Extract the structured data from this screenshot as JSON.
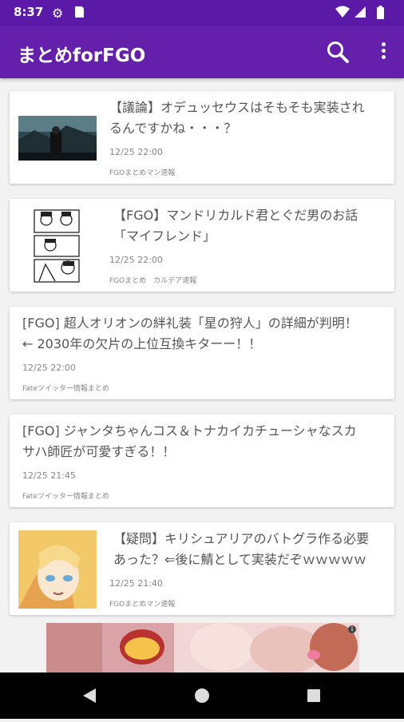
{
  "status_bar": {
    "time": "8:37",
    "icons": [
      "gear-icon",
      "sd-card-icon",
      "wifi-icon",
      "signal-icon",
      "battery-icon"
    ]
  },
  "app_bar": {
    "title": "まとめforFGO",
    "actions": [
      "search-icon",
      "more-vert-icon"
    ],
    "color": "#6420aa"
  },
  "articles": [
    {
      "title_line1": "【議論】オデュッセウスはそもそも実装され",
      "title_line2": "るんですかね・・・？",
      "time": "12/25 22:00",
      "source": "FGOまとめマン速報",
      "has_thumbnail": true
    },
    {
      "title_line1": "【FGO】マンドリカルド君とぐだ男のお話",
      "title_line2": "「マイフレンド」",
      "time": "12/25 22:00",
      "source": "FGOまとめ　カルデア速報",
      "has_thumbnail": true
    },
    {
      "title_line1": "[FGO] 超人オリオンの絆礼装「星の狩人」の詳細が判明！",
      "title_line2": "← 2030年の欠片の上位互換キターー！！",
      "time": "12/25 22:00",
      "source": "Fateツイッター情報まとめ",
      "has_thumbnail": false
    },
    {
      "title_line1": "[FGO] ジャンタちゃんコス＆トナカイカチューシャなスカ",
      "title_line2": "サハ師匠が可愛すぎる！！",
      "time": "12/25 21:45",
      "source": "Fateツイッター情報まとめ",
      "has_thumbnail": false
    },
    {
      "title_line1": "【疑問】キリシュアリアのバトグラ作る必要",
      "title_line2": "あった？⇐後に鯖として実装だぞｗｗｗｗｗ",
      "time": "12/25 21:40",
      "source": "FGOまとめマン速報",
      "has_thumbnail": true
    }
  ],
  "ad_banner": {
    "info_icon": "info-icon"
  },
  "nav_bar": {
    "buttons": [
      "back-icon",
      "home-icon",
      "recents-icon"
    ]
  }
}
